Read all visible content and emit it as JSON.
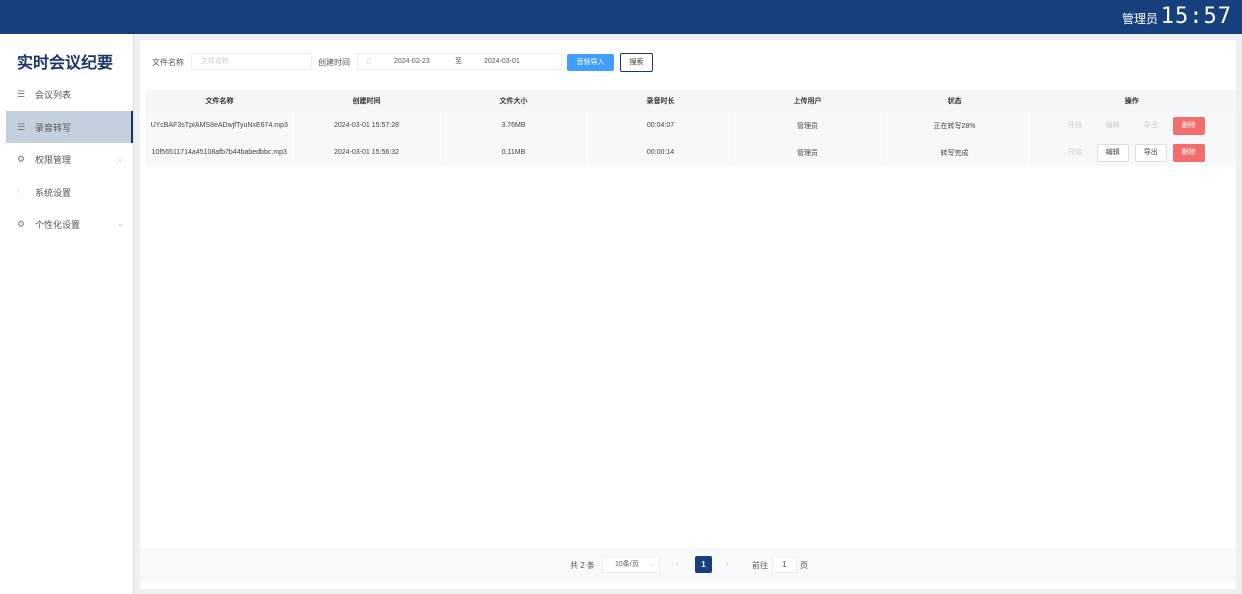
{
  "header": {
    "user": "管理员",
    "clock": "15:57"
  },
  "sidebar": {
    "title": "实时会议纪要",
    "items": [
      {
        "label": "会议列表"
      },
      {
        "label": "录音转写"
      },
      {
        "label": "权限管理"
      },
      {
        "label": "系统设置"
      },
      {
        "label": "个性化设置"
      }
    ]
  },
  "filters": {
    "file_name_label": "文件名称",
    "file_name_placeholder": "文件名称",
    "created_label": "创建时间",
    "date_start": "2024-02-23",
    "date_sep": "至",
    "date_end": "2024-03-01",
    "import_label": "音频导入",
    "search_label": "搜索"
  },
  "table": {
    "headers": [
      "文件名称",
      "创建时间",
      "文件大小",
      "录音时长",
      "上传用户",
      "状态",
      "操作"
    ],
    "rows": [
      {
        "name": "UYcBAF3sTpIAMS8eADwjfTyuNxE674.mp3",
        "created": "2024-03-01 15:57:28",
        "size": "3.76MB",
        "duration": "00:04:07",
        "user": "管理员",
        "status": "正在转写28%"
      },
      {
        "name": "10f56511714a45108afb7b44babedbbc.mp3",
        "created": "2024-03-01 15:56:32",
        "size": "0.11MB",
        "duration": "00:00:14",
        "user": "管理员",
        "status": "转写完成"
      }
    ],
    "actions": {
      "start": "开始",
      "edit": "编辑",
      "export": "导出",
      "delete": "删除"
    }
  },
  "pagination": {
    "total": "共 2 条",
    "page_size": "10条/页",
    "current": "1",
    "goto_label": "前往",
    "goto_value": "1",
    "page_unit": "页"
  }
}
